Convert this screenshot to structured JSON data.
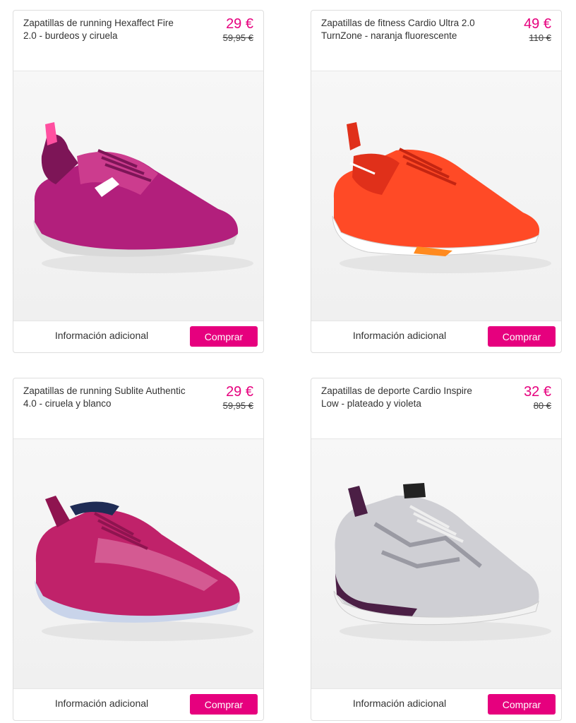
{
  "accent_color": "#e6007e",
  "products": [
    {
      "title": "Zapatillas de running Hexaffect Fire 2.0 - burdeos y ciruela",
      "price": "29 €",
      "old_price": "59,95 €",
      "info_label": "Información adicional",
      "buy_label": "Comprar",
      "image_icon": "pink-running-shoe-image",
      "colors": {
        "upper": "#b21f7c",
        "upper_dark": "#7d1557",
        "sole": "#d9d9d9",
        "accent": "#ff4fa0"
      }
    },
    {
      "title": "Zapatillas de fitness Cardio Ultra 2.0 TurnZone - naranja fluorescente",
      "price": "49 €",
      "old_price": "110 €",
      "info_label": "Información adicional",
      "buy_label": "Comprar",
      "image_icon": "orange-fitness-shoe-image",
      "colors": {
        "upper": "#ff4a26",
        "upper_dark": "#e0301a",
        "sole": "#ffffff",
        "accent": "#ff8a1f"
      }
    },
    {
      "title": "Zapatillas de running Sublite Authentic 4.0 - ciruela y blanco",
      "price": "29 €",
      "old_price": "59,95 €",
      "info_label": "Información adicional",
      "buy_label": "Comprar",
      "image_icon": "plum-running-shoe-image",
      "colors": {
        "upper": "#c0226a",
        "upper_dark": "#8f1450",
        "sole": "#c9d4ea",
        "accent": "#1f2c55"
      }
    },
    {
      "title": "Zapatillas de deporte Cardio Inspire Low - plateado y violeta",
      "price": "32 €",
      "old_price": "80 €",
      "info_label": "Información adicional",
      "buy_label": "Comprar",
      "image_icon": "silver-violet-shoe-image",
      "colors": {
        "upper": "#cfcfd4",
        "upper_dark": "#9a9aa3",
        "sole": "#f2f2f2",
        "accent": "#4b1f45"
      }
    }
  ]
}
